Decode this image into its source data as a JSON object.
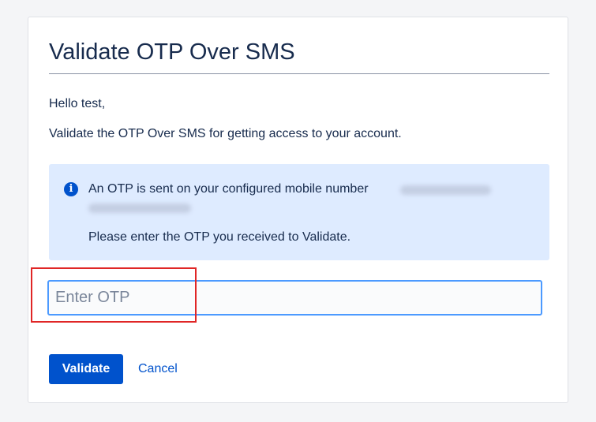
{
  "dialog": {
    "title": "Validate OTP Over SMS",
    "greeting": "Hello test,",
    "instruction": "Validate the OTP Over SMS for getting access to your account."
  },
  "info": {
    "icon": "info-icon",
    "line1": "An OTP is sent on your configured mobile number",
    "line2": "Please enter the OTP you received to Validate.",
    "box_color": "#deebff",
    "icon_color": "#0052cc"
  },
  "otp_field": {
    "value": "",
    "placeholder": "Enter OTP"
  },
  "actions": {
    "validate_label": "Validate",
    "cancel_label": "Cancel"
  },
  "colors": {
    "primary": "#0052cc",
    "focus_border": "#4c9aff",
    "highlight": "#e02626"
  }
}
